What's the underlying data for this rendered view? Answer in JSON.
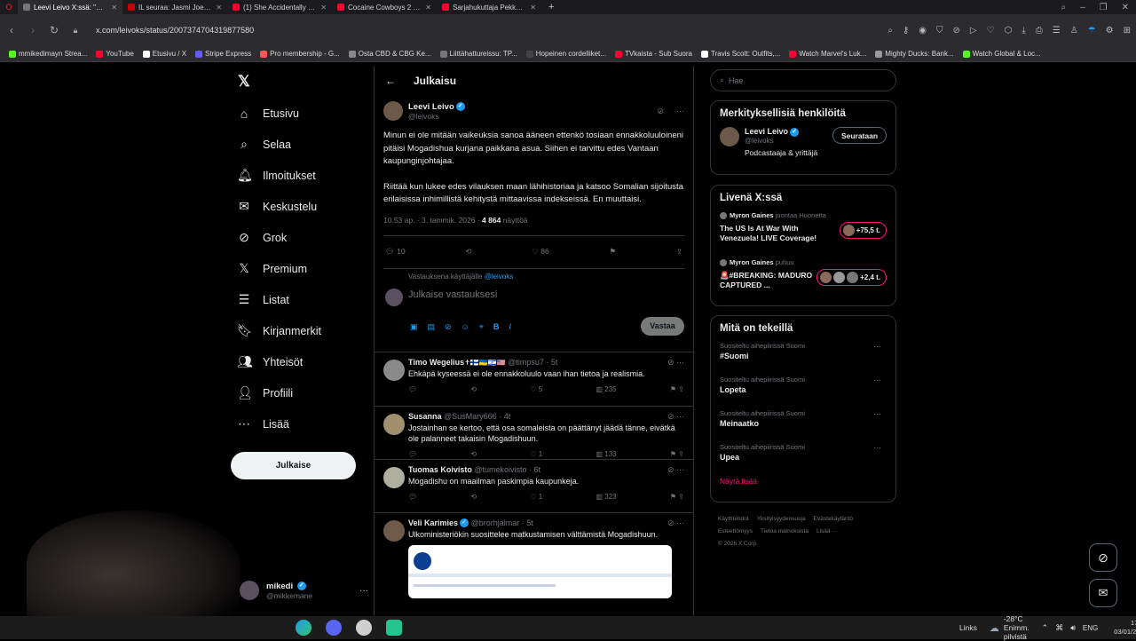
{
  "browser": {
    "tabs": [
      {
        "title": "Leevi Leivo X:ssä: \"Minun",
        "color": "#777777",
        "active": true
      },
      {
        "title": "IL seuraa: Jasmi Joensuu jo",
        "color": "#cc0000",
        "active": false
      },
      {
        "title": "(1) She Accidentally Expo",
        "color": "#ff0033",
        "active": false
      },
      {
        "title": "Cocaine Cowboys 2 Hustl",
        "color": "#ff0033",
        "active": false
      },
      {
        "title": "Sarjahukuttaja Pekka Sepp",
        "color": "#ff0033",
        "active": false
      }
    ],
    "new_tab": "+",
    "url": "x.com/leivoks/status/2007374704319877580",
    "bookmarks": [
      {
        "label": "mmikedimayn Strea...",
        "color": "#53fc18"
      },
      {
        "label": "YouTube",
        "color": "#ff0033"
      },
      {
        "label": "Etusivu / X",
        "color": "#ffffff"
      },
      {
        "label": "Stripe Express",
        "color": "#635bff"
      },
      {
        "label": "Pro membership - G...",
        "color": "#ff5555"
      },
      {
        "label": "Osta CBD & CBG Ke...",
        "color": "#888888"
      },
      {
        "label": "Liittähattureissu: TP...",
        "color": "#777777"
      },
      {
        "label": "Hopeinen cordelliket...",
        "color": "#444444"
      },
      {
        "label": "TVkaista - Sub Suora",
        "color": "#ff0033"
      },
      {
        "label": "Travis Scott: Outfits,...",
        "color": "#ffffff"
      },
      {
        "label": "Watch Marvel's Luk...",
        "color": "#ff0033"
      },
      {
        "label": "Mighty Ducks: Bank...",
        "color": "#999999"
      },
      {
        "label": "Watch Global & Loc...",
        "color": "#53fc18"
      }
    ]
  },
  "nav": {
    "items": [
      {
        "label": "Etusivu",
        "icon": "⌂",
        "name": "home-icon"
      },
      {
        "label": "Selaa",
        "icon": "⌕",
        "name": "search-icon"
      },
      {
        "label": "Ilmoitukset",
        "icon": "🔔︎",
        "name": "bell-icon"
      },
      {
        "label": "Keskustelu",
        "icon": "✉",
        "name": "mail-icon"
      },
      {
        "label": "Grok",
        "icon": "⊘",
        "name": "grok-icon"
      },
      {
        "label": "Premium",
        "icon": "𝕏",
        "name": "x-premium-icon"
      },
      {
        "label": "Listat",
        "icon": "☰",
        "name": "list-icon"
      },
      {
        "label": "Kirjanmerkit",
        "icon": "🔖︎",
        "name": "bookmark-icon"
      },
      {
        "label": "Yhteisöt",
        "icon": "👥︎",
        "name": "communities-icon"
      },
      {
        "label": "Profiili",
        "icon": "👤︎",
        "name": "profile-icon"
      },
      {
        "label": "Lisää",
        "icon": "⋯",
        "name": "more-circle-icon"
      }
    ],
    "post_button": "Julkaise",
    "account": {
      "name": "mikedi",
      "handle": "@mikkemane",
      "more": "···"
    }
  },
  "post": {
    "header": "Julkaisu",
    "author": {
      "name": "Leevi Leivo",
      "handle": "@leivoks"
    },
    "text_p1": "Minun ei ole mitään vaikeuksia sanoa ääneen ettenkö tosiaan ennakkoluuloineni pitäisi Mogadishua kurjana paikkana asua. Siihen ei tarvittu edes Vantaan kaupunginjohtajaa.",
    "text_p2": "Riittää kun lukee edes vilauksen maan lähihistoriaa ja katsoo Somalian sijoitusta erilaisissa inhimillistä kehitystä mittaavissa indekseissä. En muuttaisi.",
    "time": "10.53 ap. · 3. tammik. 2026 ·",
    "views": "4 864",
    "views_label": "näyttöä",
    "replies": "10",
    "likes": "86"
  },
  "composer": {
    "replying_to": "Vastauksena käyttäjälle",
    "replying_handle": "@leivoks",
    "placeholder": "Julkaise vastauksesi",
    "button": "Vastaa"
  },
  "replies": [
    {
      "name": "Timo Wegelius",
      "flags": "✝🇫🇮🇺🇦🇮🇱🇺🇸",
      "handle": "@timpsu7 · 5t",
      "text": "Ehkäpä kyseessä ei ole ennakkoluulo vaan ihan tietoa ja realismia.",
      "replies": "",
      "likes": "5",
      "views": "235",
      "verified": false
    },
    {
      "name": "Susanna",
      "flags": "",
      "handle": "@SusMary666 · 4t",
      "text": "Jostainhan se kertoo, että osa somaleista on päättänyt jäädä tänne, eivätkä ole palanneet takaisin Mogadishuun.",
      "replies": "",
      "likes": "1",
      "views": "133",
      "verified": false
    },
    {
      "name": "Tuomas Koivisto",
      "flags": "",
      "handle": "@tumekoivisto · 6t",
      "text": "Mogadishu on maailman paskimpia kaupunkeja.",
      "replies": "",
      "likes": "1",
      "views": "323",
      "verified": false
    },
    {
      "name": "Veli Karimies",
      "flags": "",
      "handle": "@brorhjalmar · 5t",
      "text": "Ulkoministeriökin suosittelee matkustamisen välttämistä Mogadishuun.",
      "replies": "",
      "likes": "",
      "views": "",
      "verified": true
    }
  ],
  "sidebar": {
    "search_placeholder": "Hae",
    "relevant_title": "Merkityksellisiä henkilöitä",
    "relevant": {
      "name": "Leevi Leivo",
      "handle": "@leivoks",
      "bio": "Podcastaaja & yrittäjä",
      "button": "Seurataan"
    },
    "live_title": "Livenä X:ssä",
    "live": [
      {
        "host": "Myron Gaines",
        "action": "juontaa Huonetta",
        "title": "The US Is At War With Venezuela! LIVE Coverage!",
        "count": "+75,5 t."
      },
      {
        "host": "Myron Gaines",
        "action": "puhuu",
        "title": "🚨#BREAKING: MADURO CAPTURED ...",
        "count": "+2,4 t."
      }
    ],
    "trends_title": "Mitä on tekeillä",
    "trends": [
      {
        "category": "Suositeltu aihepiirissä Suomi",
        "name": "#Suomi"
      },
      {
        "category": "Suositeltu aihepiirissä Suomi",
        "name": "Lopeta"
      },
      {
        "category": "Suositeltu aihepiirissä Suomi",
        "name": "Meinaatko"
      },
      {
        "category": "Suositeltu aihepiirissä Suomi",
        "name": "Upea"
      }
    ],
    "show_more": "Näytä lisää",
    "footer": [
      "Käyttöehdot",
      "Yksityisyydensuoja",
      "Evästekäytäntö",
      "Esteettömyys",
      "Tietoa mainoksista",
      "Lisää ···",
      "© 2026 X Corp."
    ]
  },
  "taskbar": {
    "links": "Links",
    "weather": "-28°C  Enimm. pilvistä",
    "lang": "ENG",
    "time": "17.46",
    "date": "03/01/2026"
  },
  "colors": {
    "accent": "#1d9bf0",
    "live_pink": "#f91880"
  }
}
